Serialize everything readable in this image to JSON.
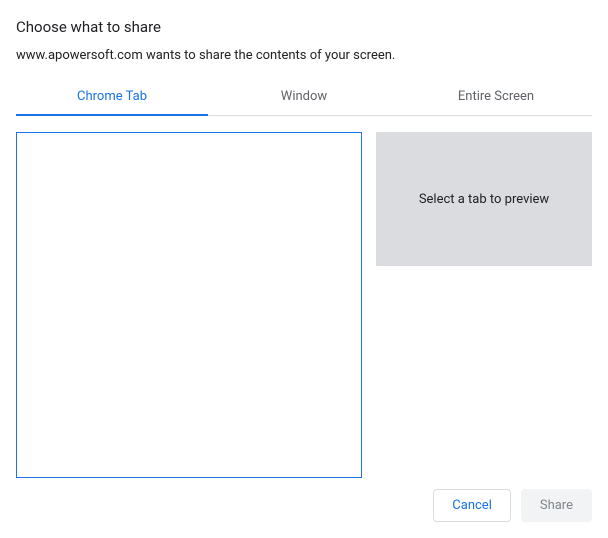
{
  "dialog": {
    "title": "Choose what to share",
    "subtitle": "www.apowersoft.com wants to share the contents of your screen."
  },
  "tabs": {
    "chrome_tab": "Chrome Tab",
    "window": "Window",
    "entire_screen": "Entire Screen",
    "active": "chrome_tab"
  },
  "preview": {
    "placeholder": "Select a tab to preview"
  },
  "footer": {
    "cancel_label": "Cancel",
    "share_label": "Share"
  }
}
